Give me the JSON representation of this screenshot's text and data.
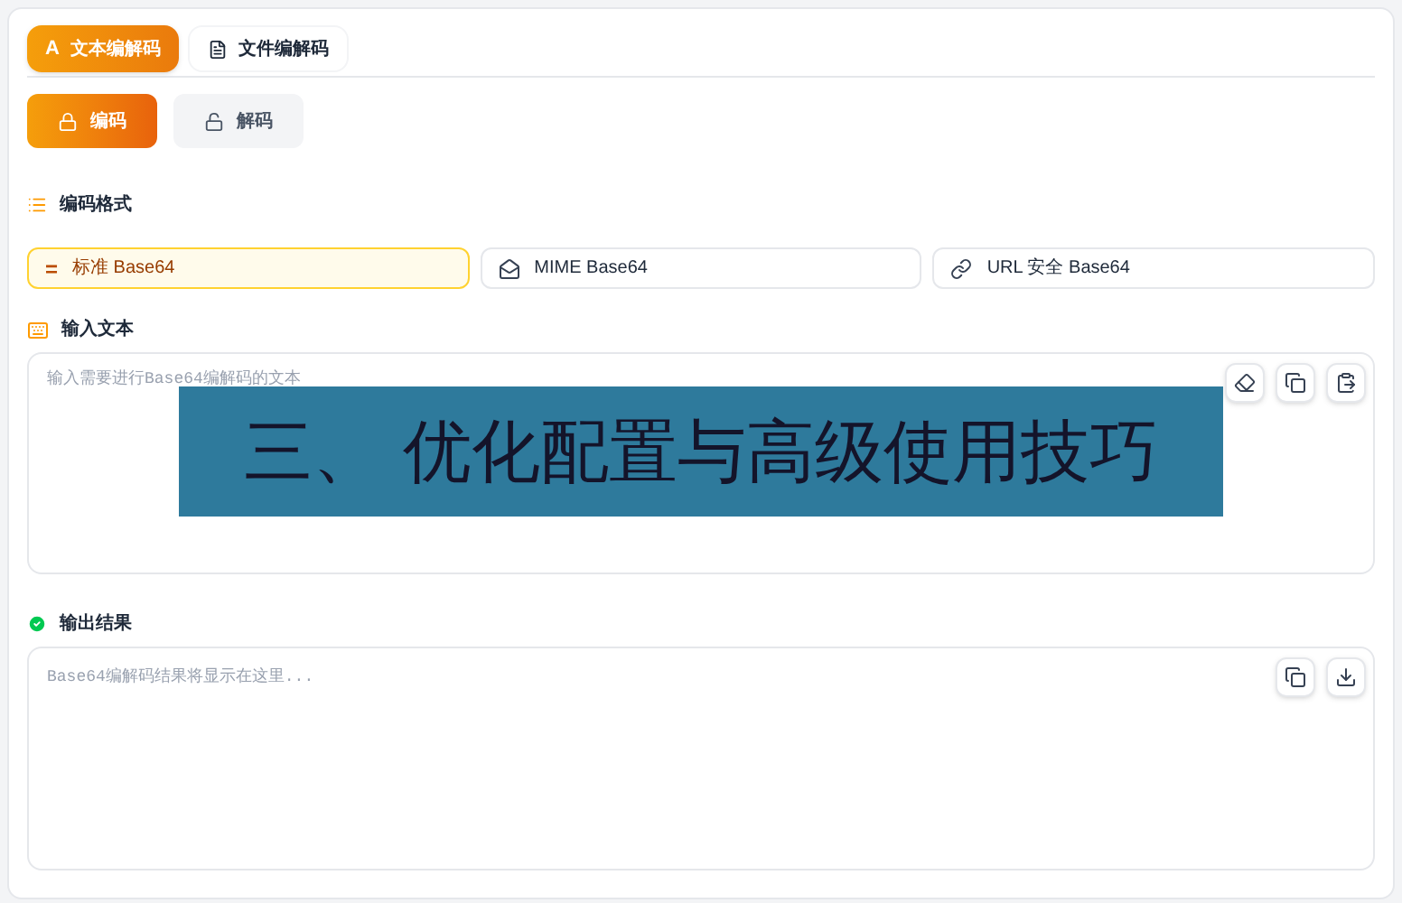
{
  "tabs": [
    {
      "label": "文本编解码",
      "icon": "A",
      "selected": true
    },
    {
      "label": "文件编解码",
      "selected": false
    }
  ],
  "modes": [
    {
      "label": "编码",
      "kind": "lock",
      "selected": true
    },
    {
      "label": "解码",
      "kind": "unlock",
      "selected": false
    }
  ],
  "format": {
    "title": "编码格式",
    "options": [
      {
        "label": "标准 Base64",
        "icon": "=",
        "kind": "equals",
        "selected": true
      },
      {
        "label": "MIME Base64",
        "kind": "mail",
        "selected": false
      },
      {
        "label": "URL 安全 Base64",
        "kind": "link",
        "selected": false
      }
    ]
  },
  "input": {
    "title": "输入文本",
    "placeholder": "输入需要进行Base64编解码的文本",
    "actions": [
      {
        "kind": "clear"
      },
      {
        "kind": "copy"
      },
      {
        "kind": "paste"
      }
    ]
  },
  "output": {
    "title": "输出结果",
    "placeholder": "Base64编解码结果将显示在这里...",
    "actions": [
      {
        "kind": "copy"
      },
      {
        "kind": "download"
      }
    ]
  },
  "banner": {
    "text": "三、 优化配置与高级使用技巧"
  }
}
